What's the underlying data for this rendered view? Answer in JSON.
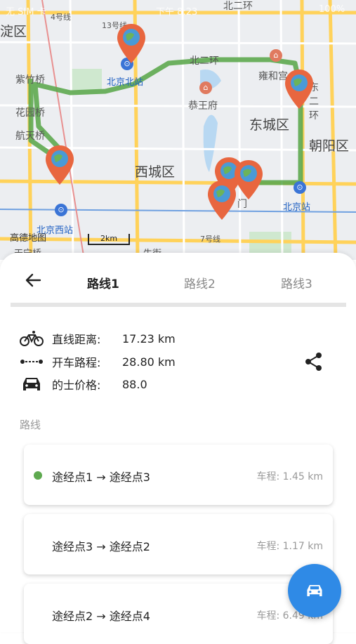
{
  "status_bar": {
    "left": "无 SIM 卡",
    "time": "下午 8:23",
    "battery": "100%"
  },
  "map": {
    "labels": {
      "dingqu": "淀区",
      "zizhuqiao": "紫竹桥",
      "huayuanqiao": "花园桥",
      "hangtianqiao": "航天桥",
      "beijing_north": "北京北站",
      "bei_er_huan_top": "北二环",
      "bei_er_huan": "北二环",
      "yonghegong": "雍和宫",
      "gongwangfu": "恭王府",
      "dongcheng": "东城区",
      "dong_er_huan": "东二环",
      "chaoyang": "朝阳区",
      "xicheng": "西城区",
      "beijing_west": "北京西站",
      "beijing_station": "北京站",
      "line13": "13号线",
      "line4": "4号线",
      "line7": "7号线",
      "men": "门",
      "tianqiao": "天宁桥",
      "niujie": "牛街"
    },
    "logo": "高德地图",
    "scale": "2km",
    "route_color": "#5ea94f",
    "pin_color": "#e8663f"
  },
  "sheet": {
    "tabs": [
      "路线1",
      "路线2",
      "路线3"
    ],
    "info": [
      {
        "icon": "bicycle-icon",
        "label": "直线距离:",
        "value": "17.23 km"
      },
      {
        "icon": "dotted-line-icon",
        "label": "开车路程:",
        "value": "28.80 km"
      },
      {
        "icon": "car-icon",
        "label": "的士价格:",
        "value": "88.0"
      }
    ],
    "section_title": "路线",
    "routes": [
      {
        "route": "途经点1 → 途经点3",
        "dist": "车程: 1.45 km",
        "active": true
      },
      {
        "route": "途经点3 → 途经点2",
        "dist": "车程: 1.17 km",
        "active": false
      },
      {
        "route": "途经点2 → 途经点4",
        "dist": "车程: 6.49 km",
        "active": false
      }
    ]
  }
}
